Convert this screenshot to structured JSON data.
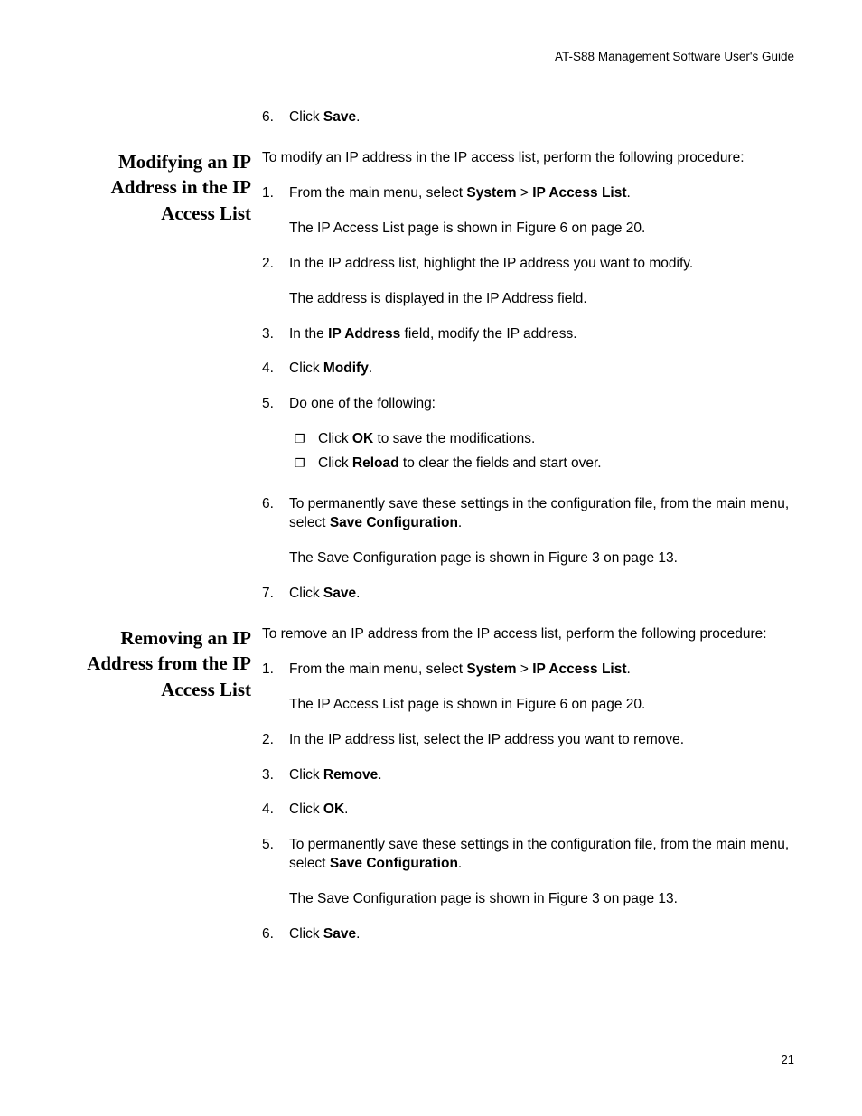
{
  "header": "AT-S88 Management Software User's Guide",
  "pageNumber": "21",
  "topStep": {
    "num": "6.",
    "text_a": "Click ",
    "text_b": "Save",
    "text_c": "."
  },
  "section1": {
    "heading": "Modifying an IP Address in the IP Access List",
    "intro": "To modify an IP address in the IP access list, perform the following procedure:",
    "steps": [
      {
        "num": "1.",
        "parts": [
          "From the main menu, select ",
          "System",
          " > ",
          "IP Access List",
          "."
        ],
        "after": "The IP Access List page is shown in Figure 6 on page 20."
      },
      {
        "num": "2.",
        "parts": [
          "In the IP address list, highlight the IP address you want to modify."
        ],
        "after": "The address is displayed in the IP Address field."
      },
      {
        "num": "3.",
        "parts": [
          "In the ",
          "IP Address",
          " field, modify the IP address."
        ]
      },
      {
        "num": "4.",
        "parts": [
          "Click ",
          "Modify",
          "."
        ]
      },
      {
        "num": "5.",
        "parts": [
          "Do one of the following:"
        ],
        "sub": [
          {
            "parts": [
              "Click ",
              "OK",
              " to save the modifications."
            ]
          },
          {
            "parts": [
              "Click ",
              "Reload",
              " to clear the fields and start over."
            ]
          }
        ]
      },
      {
        "num": "6.",
        "parts": [
          "To permanently save these settings in the configuration file, from the main menu, select ",
          "Save Configuration",
          "."
        ],
        "after": "The Save Configuration page is shown in Figure 3 on page 13."
      },
      {
        "num": "7.",
        "parts": [
          "Click ",
          "Save",
          "."
        ]
      }
    ]
  },
  "section2": {
    "heading": "Removing an IP Address from the IP Access List",
    "intro": "To remove an IP address from the IP access list, perform the following procedure:",
    "steps": [
      {
        "num": "1.",
        "parts": [
          "From the main menu, select ",
          "System",
          " > ",
          "IP Access List",
          "."
        ],
        "after": "The IP Access List page is shown in Figure 6 on page 20."
      },
      {
        "num": "2.",
        "parts": [
          "In the IP address list, select the IP address you want to remove."
        ]
      },
      {
        "num": "3.",
        "parts": [
          "Click ",
          "Remove",
          "."
        ]
      },
      {
        "num": "4.",
        "parts": [
          "Click ",
          "OK",
          "."
        ]
      },
      {
        "num": "5.",
        "parts": [
          "To permanently save these settings in the configuration file, from the main menu, select ",
          "Save Configuration",
          "."
        ],
        "after": "The Save Configuration page is shown in Figure 3 on page 13."
      },
      {
        "num": "6.",
        "parts": [
          "Click ",
          "Save",
          "."
        ]
      }
    ]
  }
}
